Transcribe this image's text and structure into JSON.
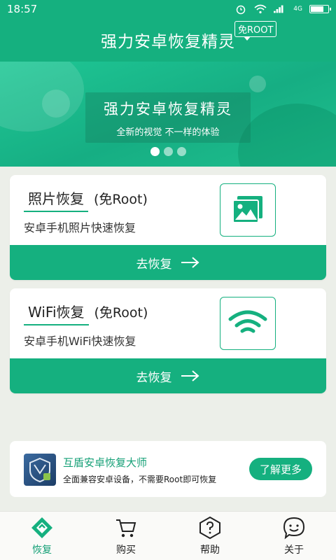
{
  "status": {
    "time": "18:57",
    "network": "4G"
  },
  "header": {
    "title": "强力安卓恢复精灵",
    "badge": "免ROOT"
  },
  "banner": {
    "title": "强力安卓恢复精灵",
    "subtitle": "全新的视觉 不一样的体验",
    "slide_count": 3,
    "active_slide": 1
  },
  "cards": [
    {
      "title": "照片恢复",
      "tag": "(免Root)",
      "desc": "安卓手机照片快速恢复",
      "icon": "photo-icon",
      "button": "去恢复"
    },
    {
      "title": "WiFi恢复",
      "tag": "(免Root)",
      "desc": "安卓手机WiFi快速恢复",
      "icon": "wifi-icon",
      "button": "去恢复"
    }
  ],
  "promo": {
    "title": "互盾安卓恢复大师",
    "desc": "全面兼容安卓设备，不需要Root即可恢复",
    "button": "了解更多"
  },
  "tabs": [
    {
      "label": "恢复",
      "icon": "recover-icon",
      "active": true
    },
    {
      "label": "购买",
      "icon": "cart-icon",
      "active": false
    },
    {
      "label": "帮助",
      "icon": "help-icon",
      "active": false
    },
    {
      "label": "关于",
      "icon": "smile-icon",
      "active": false
    }
  ],
  "colors": {
    "accent": "#15b07f"
  }
}
